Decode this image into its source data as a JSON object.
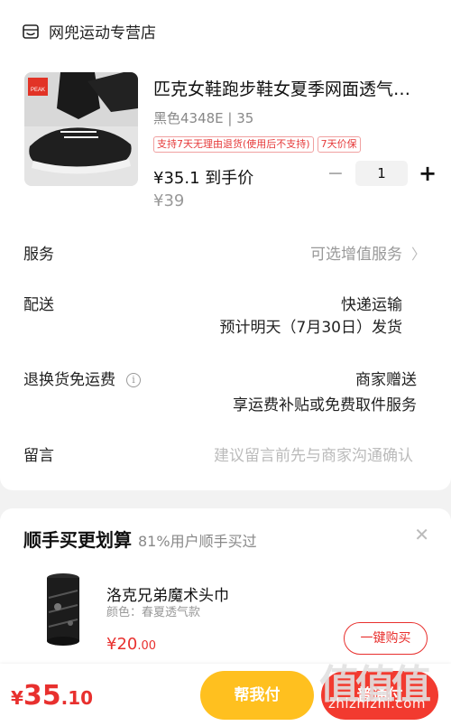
{
  "shop": {
    "name": "网兜运动专营店",
    "icon": "shop-icon"
  },
  "product": {
    "title": "匹克女鞋跑步鞋女夏季网面透气…",
    "variant": "黑色4348E | 35",
    "tags": [
      "支持7天无理由退货(使用后不支持)",
      "7天价保"
    ],
    "price": "¥35.1 到手价",
    "original_price": "¥39",
    "quantity": "1",
    "minus_label": "−",
    "plus_label": "+",
    "brand_logo_text": "PEAK"
  },
  "rows": {
    "service": {
      "label": "服务",
      "value": "可选增值服务",
      "chevron": "〉"
    },
    "delivery": {
      "label": "配送",
      "method": "快递运输",
      "eta": "预计明天（7月30日）发货"
    },
    "returns": {
      "label": "退换货免运费",
      "info": "i",
      "value": "商家赠送",
      "detail": "享运费补贴或免费取件服务"
    },
    "message": {
      "label": "留言",
      "placeholder": "建议留言前先与商家沟通确认"
    }
  },
  "recommend": {
    "title": "顺手买更划算",
    "subtitle": "81%用户顺手买过",
    "close": "✕",
    "item": {
      "name": "洛克兄弟魔术头巾",
      "spec": "颜色：春夏透气款",
      "price_currency": "¥",
      "price_int": "20",
      "price_dec": ".00",
      "button": "一键购买"
    }
  },
  "footer": {
    "currency": "¥",
    "total_int": "35",
    "total_dec": ".10",
    "help_pay": "帮我付",
    "pay": "普通付"
  },
  "watermark": {
    "glyphs": "值值值",
    "text": "zhizhizhi.com"
  },
  "colors": {
    "accent_red": "#e8302e",
    "help_yellow": "#ffc01f",
    "pay_red": "#f23a2f"
  }
}
